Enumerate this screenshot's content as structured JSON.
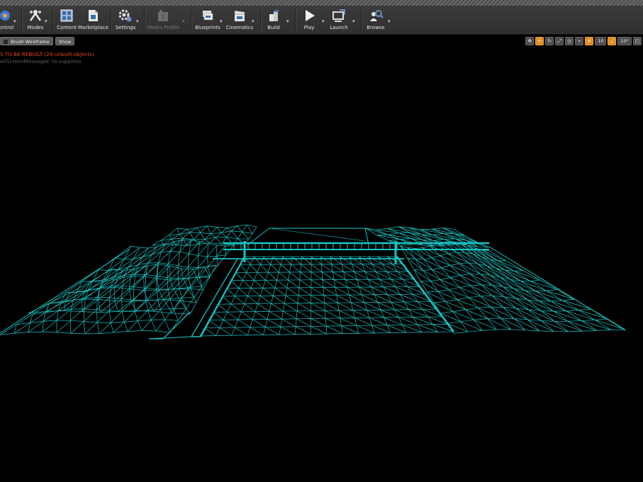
{
  "toolbar": {
    "buttons": [
      {
        "label": "ontrol",
        "icon": "source-control-icon"
      },
      {
        "label": "Modes",
        "icon": "modes-icon"
      },
      {
        "label": "Content",
        "icon": "content-browser-icon"
      },
      {
        "label": "Marketplace",
        "icon": "marketplace-icon"
      },
      {
        "label": "Settings",
        "icon": "settings-icon"
      },
      {
        "label": "Media Profile",
        "icon": "media-profile-icon",
        "disabled": true
      },
      {
        "label": "Blueprints",
        "icon": "blueprints-icon"
      },
      {
        "label": "Cinematics",
        "icon": "cinematics-icon"
      },
      {
        "label": "Build",
        "icon": "build-icon"
      },
      {
        "label": "Play",
        "icon": "play-icon"
      },
      {
        "label": "Launch",
        "icon": "launch-icon"
      },
      {
        "label": "Browse",
        "icon": "browse-icon"
      }
    ]
  },
  "viewport": {
    "view_mode": "Brush Wireframe",
    "show_label": "Show",
    "grid_snap_value": "10",
    "rotation_snap_value": "10°",
    "warning_text": "S TO BE REBUILT (29 unbuilt objects)",
    "suppress_hint": "AllScreenMessages' to suppress",
    "wireframe_color": "#19c3c3"
  },
  "colors": {
    "toolbar_bg": "#333333",
    "accent": "#e08a1a",
    "warning": "#e8461e"
  }
}
